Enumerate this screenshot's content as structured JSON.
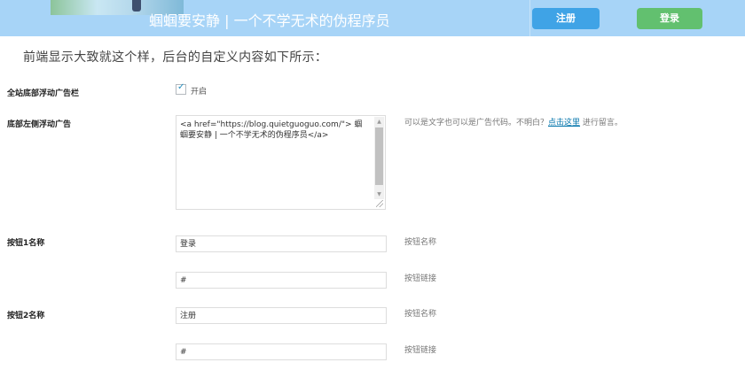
{
  "header": {
    "title": "蝈蝈要安静 | 一个不学无术的伪程序员",
    "register_label": "注册",
    "login_label": "登录",
    "colors": {
      "banner": "#a7d4f7",
      "register": "#3fa3e6",
      "login": "#62c06f"
    }
  },
  "intro_text": "前端显示大致就这个样，后台的自定义内容如下所示：",
  "settings": {
    "float_ad": {
      "label": "全站底部浮动广告栏",
      "checked": true,
      "checkbox_label": "开启"
    },
    "left_ad": {
      "label": "底部左侧浮动广告",
      "value": "<a href=\"https://blog.quietguoguo.com/\"> 蝈蝈要安静 | 一个不学无术的伪程序员</a>",
      "hint_prefix": "可以是文字也可以是广告代码。不明白？",
      "hint_link": "点击这里",
      "hint_suffix": " 进行留言。"
    },
    "button1": {
      "label": "按钮1名称",
      "name_value": "登录",
      "name_hint": "按钮名称",
      "link_value": "#",
      "link_hint": "按钮链接"
    },
    "button2": {
      "label": "按钮2名称",
      "name_value": "注册",
      "name_hint": "按钮名称",
      "link_value": "#",
      "link_hint": "按钮链接"
    }
  }
}
